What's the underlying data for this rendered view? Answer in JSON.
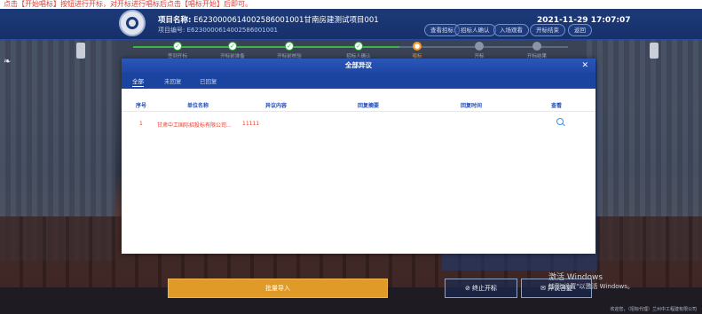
{
  "top_strip_text": "点击【开始唱标】按钮进行开标，对开标进行唱标后点击【唱标开始】后即可。",
  "header": {
    "project_name_label": "项目名称:",
    "project_name_value": "E6230000614002586001001甘南房建测试项目001",
    "project_code_label": "项目编号:",
    "project_code_value": "E6230000614002586001001",
    "buttons": [
      "查看招标",
      "招标人确认",
      "入场观看",
      "开标结束",
      "返回"
    ],
    "datetime": "2021-11-29  17:07:07"
  },
  "steps": {
    "items": [
      "签到开标",
      "开标前准备",
      "开标前核验",
      "招标人确认",
      "唱标",
      "开标",
      "开标结果"
    ],
    "current_index": 4
  },
  "modal": {
    "title": "全部异议",
    "tabs": [
      "全部",
      "未回复",
      "已回复"
    ],
    "columns": [
      "序号",
      "单位名称",
      "异议内容",
      "回复摘要",
      "回复时间",
      "查看"
    ],
    "rows": [
      {
        "seq": "1",
        "unit": "甘肃中工国际招投标有限公司...",
        "content": "11111",
        "summary": "",
        "time": ""
      }
    ]
  },
  "bottom": {
    "import_button": "批量导入",
    "stop_button": "终止开标",
    "reply_button": "异议答复"
  },
  "watermark": {
    "line1": "激活 Windows",
    "line2": "转到\"设置\"以激活 Windows。"
  },
  "footer_note": "欢迎您，（招标代理）兰州中工程建有限公司",
  "colors": {
    "header_bg": "#1d3a78",
    "modal_title_bg": "#2a56b8",
    "accent_orange": "#e09a28",
    "step_done": "#39b54a",
    "step_current": "#f0a030",
    "row_text": "#e8392c"
  }
}
